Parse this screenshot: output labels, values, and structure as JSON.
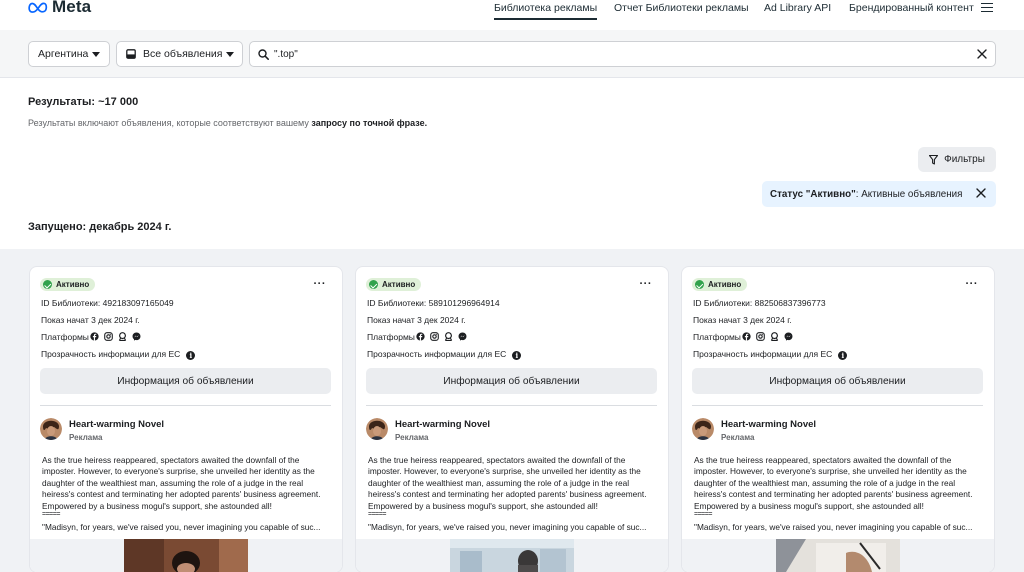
{
  "header": {
    "logo_text": "Meta",
    "nav": [
      {
        "label": "Библиотека рекламы",
        "active": true
      },
      {
        "label": "Отчет Библиотеки рекламы",
        "active": false
      },
      {
        "label": "Ad Library API",
        "active": false
      },
      {
        "label": "Брендированный контент",
        "active": false
      }
    ],
    "menu_icon": "hamburger-icon"
  },
  "search": {
    "country": "Аргентина",
    "category": "Все объявления",
    "query": "\".top\"",
    "search_icon": "search-icon",
    "clear_icon": "close-icon"
  },
  "results": {
    "title": "Результаты: ~17 000",
    "desc_prefix": "Результаты включают объявления, которые соответствуют вашему",
    "desc_bold": "запросу по точной фразе.",
    "filters_label": "Фильтры",
    "active_filter_bold": "Статус \"Активно\"",
    "active_filter_text": ": Активные объявления",
    "launched": "Запущено: декабрь 2024 г."
  },
  "colors": {
    "accent": "#0866ff",
    "active_green": "#31a24c",
    "badge_bg": "#dff0d8",
    "chip_bg": "#e7f3ff",
    "page_gray": "#f0f2f5"
  },
  "cards": [
    {
      "status": "Активно",
      "library_id": "ID Библиотеки: 492183097165049",
      "started": "Показ начат 3 дек 2024 г.",
      "platforms_label": "Платформы",
      "platform_icons": [
        "facebook-icon",
        "instagram-icon",
        "audience-network-icon",
        "messenger-icon"
      ],
      "transparency": "Прозрачность информации для ЕС",
      "details_button": "Информация об объявлении",
      "advertiser": "Heart-warming Novel",
      "sponsored": "Реклама",
      "body": "As the true heiress reappeared, spectators awaited the downfall of the imposter. However, to everyone's surprise, she unveiled her identity as the daughter of the wealthiest man, assuming the role of a judge in the real heiress's contest and terminating her adopted parents' business agreement. Empowered by a business mogul's support, she astounded all!",
      "separator": "=====",
      "quote": "\"Madisyn, for years, we've raised you, never imagining you capable of suc..."
    },
    {
      "status": "Активно",
      "library_id": "ID Библиотеки: 589101296964914",
      "started": "Показ начат 3 дек 2024 г.",
      "platforms_label": "Платформы",
      "platform_icons": [
        "facebook-icon",
        "instagram-icon",
        "audience-network-icon",
        "messenger-icon"
      ],
      "transparency": "Прозрачность информации для ЕС",
      "details_button": "Информация об объявлении",
      "advertiser": "Heart-warming Novel",
      "sponsored": "Реклама",
      "body": "As the true heiress reappeared, spectators awaited the downfall of the imposter. However, to everyone's surprise, she unveiled her identity as the daughter of the wealthiest man, assuming the role of a judge in the real heiress's contest and terminating her adopted parents' business agreement. Empowered by a business mogul's support, she astounded all!",
      "separator": "=====",
      "quote": "\"Madisyn, for years, we've raised you, never imagining you capable of suc..."
    },
    {
      "status": "Активно",
      "library_id": "ID Библиотеки: 882506837396773",
      "started": "Показ начат 3 дек 2024 г.",
      "platforms_label": "Платформы",
      "platform_icons": [
        "facebook-icon",
        "instagram-icon",
        "audience-network-icon",
        "messenger-icon"
      ],
      "transparency": "Прозрачность информации для ЕС",
      "details_button": "Информация об объявлении",
      "advertiser": "Heart-warming Novel",
      "sponsored": "Реклама",
      "body": "As the true heiress reappeared, spectators awaited the downfall of the imposter. However, to everyone's surprise, she unveiled her identity as the daughter of the wealthiest man, assuming the role of a judge in the real heiress's contest and terminating her adopted parents' business agreement. Empowered by a business mogul's support, she astounded all!",
      "separator": "=====",
      "quote": "\"Madisyn, for years, we've raised you, never imagining you capable of suc..."
    }
  ]
}
